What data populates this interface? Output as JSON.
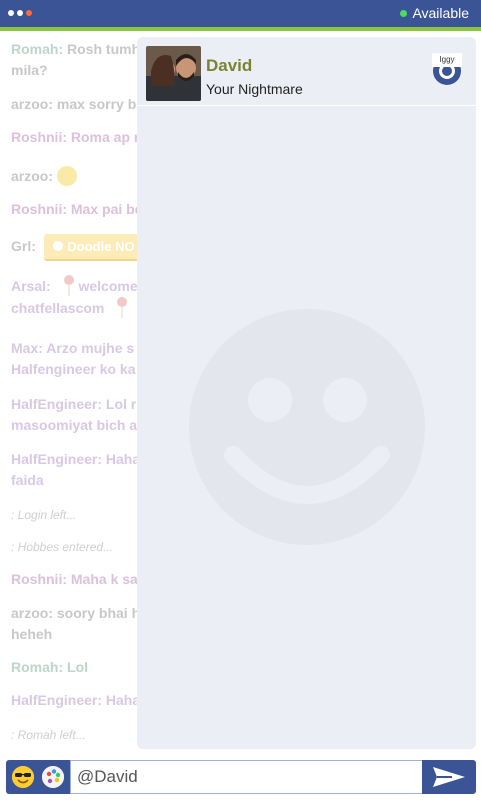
{
  "header": {
    "status_label": "Available"
  },
  "chat": {
    "messages": [
      {
        "name": "Romah:",
        "text": " Rosh tumh",
        "line2": "mila?"
      },
      {
        "name": "arzoo:",
        "text": " max sorry bl"
      },
      {
        "name": "Roshnii:",
        "text": " Roma ap n"
      },
      {
        "name": "arzoo:",
        "text": ""
      },
      {
        "name": "Roshnii:",
        "text": " Max pai bo"
      },
      {
        "name": "Grl:",
        "doodle": "Doodle NO"
      },
      {
        "name": "Arsal:",
        "text": " welcome",
        "line2": "chatfellascom"
      },
      {
        "name": "Max:",
        "text": " Arzo mujhe s",
        "line2": "Halfengineer ko ka"
      },
      {
        "name": "HalfEngineer:",
        "text": " Lol r",
        "line2": "masoomiyat bich a"
      },
      {
        "name": "HalfEngineer:",
        "text": " Haha",
        "line2": "faida"
      },
      {
        "system": ": Login left..."
      },
      {
        "system": ": Hobbes entered..."
      },
      {
        "name": "Roshnii:",
        "text": " Maha k sat"
      },
      {
        "name": "arzoo:",
        "text": " soory bhai h",
        "line2": "heheh"
      },
      {
        "name": "Romah:",
        "text": " Lol"
      },
      {
        "name": "HalfEngineer:",
        "text": " Haha"
      },
      {
        "system": ": Romah left..."
      }
    ]
  },
  "profile": {
    "name": "David",
    "status": "Your Nightmare",
    "badge_text": "Iggy"
  },
  "composer": {
    "value": "@David"
  },
  "colors": {
    "primary": "#3a5496",
    "accent_green": "#8cc63f",
    "panel_bg": "#eceef5"
  },
  "icons": [
    "dots-menu-icon",
    "online-status-icon",
    "rose-icon",
    "smiley-icon",
    "palette-icon",
    "sunglasses-emoji-icon",
    "send-icon"
  ]
}
